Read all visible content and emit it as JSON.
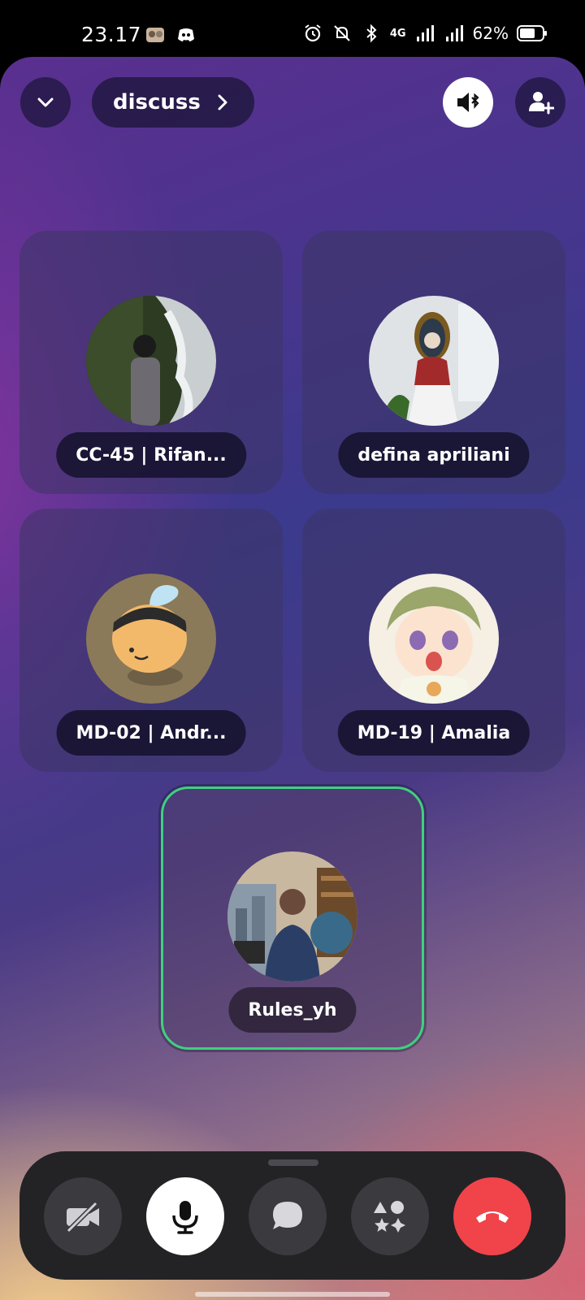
{
  "status_bar": {
    "time": "23.17",
    "network": "4G",
    "battery": "62%",
    "icons": [
      "photo-notification-icon",
      "discord-icon",
      "alarm-icon",
      "mute-icon",
      "bluetooth-icon",
      "signal-icon",
      "battery-icon"
    ]
  },
  "header": {
    "channel_name": "discuss",
    "collapse_icon": "chevron-down-icon",
    "speaker_icon": "speaker-bluetooth-icon",
    "invite_icon": "add-person-icon"
  },
  "participants": [
    {
      "name": "CC-45 | Rifan...",
      "avatar": "photo-waterfall"
    },
    {
      "name": "defina apriliani",
      "avatar": "photo-portrait"
    },
    {
      "name": "MD-02 | Andr...",
      "avatar": "bee-avatar"
    },
    {
      "name": "MD-19 | Amalia",
      "avatar": "anime-baby-avatar"
    },
    {
      "name": "Rules_yh",
      "avatar": "photo-office",
      "speaking": true
    }
  ],
  "controls": [
    {
      "id": "camera",
      "icon": "camera-off-icon"
    },
    {
      "id": "mic",
      "icon": "microphone-icon"
    },
    {
      "id": "chat",
      "icon": "chat-icon"
    },
    {
      "id": "activities",
      "icon": "activities-icon"
    },
    {
      "id": "hangup",
      "icon": "phone-hangup-icon"
    }
  ],
  "colors": {
    "speaking_ring": "#3fd07f",
    "hangup": "#f0444a",
    "control_bar": "#232326"
  }
}
